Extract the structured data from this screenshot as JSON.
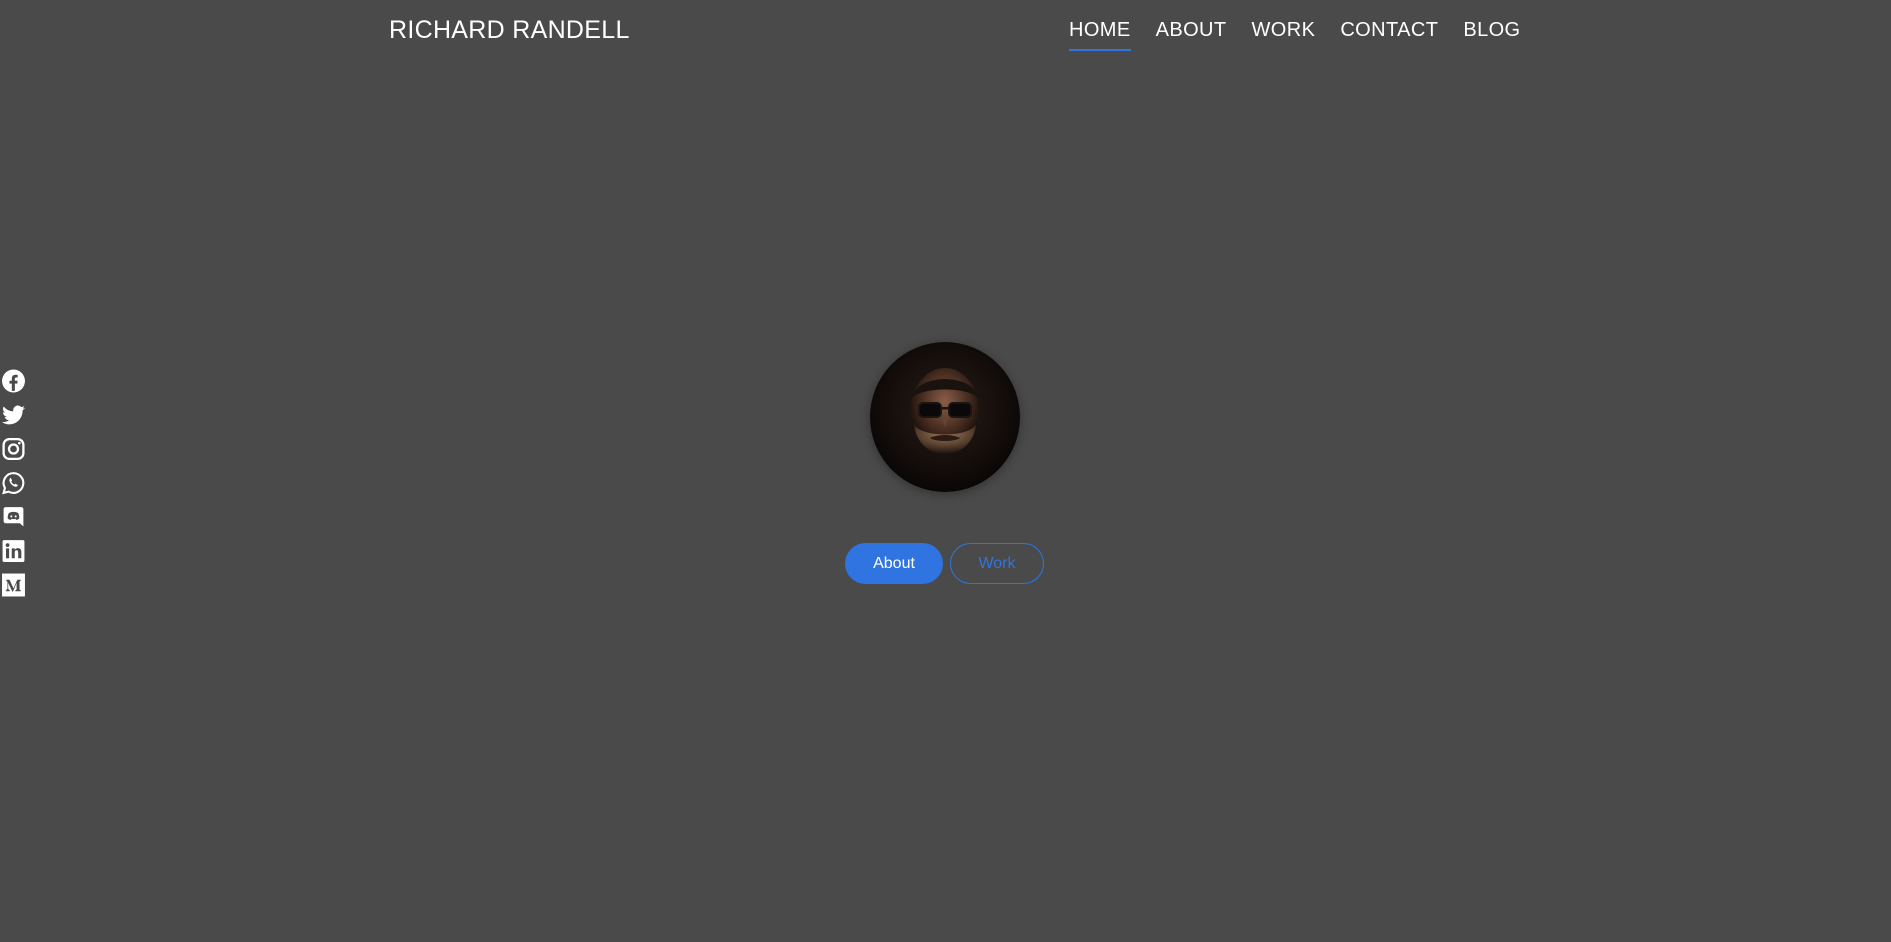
{
  "header": {
    "brand": "RICHARD RANDELL",
    "nav": [
      {
        "label": "HOME",
        "active": true
      },
      {
        "label": "ABOUT",
        "active": false
      },
      {
        "label": "WORK",
        "active": false
      },
      {
        "label": "CONTACT",
        "active": false
      },
      {
        "label": "BLOG",
        "active": false
      }
    ]
  },
  "social": [
    "facebook-icon",
    "twitter-icon",
    "instagram-icon",
    "whatsapp-icon",
    "discord-icon",
    "linkedin-icon",
    "medium-icon"
  ],
  "hero": {
    "about_label": "About",
    "work_label": "Work"
  },
  "colors": {
    "background": "#4a4a4a",
    "accent": "#2f74e0",
    "text": "#ffffff"
  }
}
